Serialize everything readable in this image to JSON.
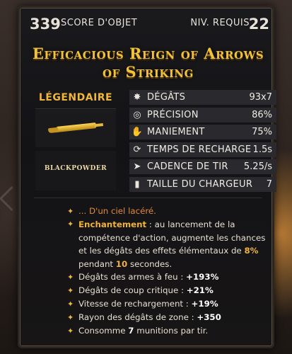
{
  "header": {
    "score_value": "339",
    "score_label": "SCORE D'OBJET",
    "level_label": "NIV. REQUIS",
    "level_value": "22"
  },
  "item": {
    "name": "Efficacious Reign of Arrows of Striking",
    "rarity": "LÉGENDAIRE",
    "brand": "BLACKPOWDER"
  },
  "stats": [
    {
      "icon": "damage-icon",
      "label": "DÉGÂTS",
      "value": "93x7"
    },
    {
      "icon": "accuracy-icon",
      "label": "PRÉCISION",
      "value": "86%"
    },
    {
      "icon": "handling-icon",
      "label": "MANIEMENT",
      "value": "75%"
    },
    {
      "icon": "reload-icon",
      "label": "TEMPS DE RECHARGE",
      "value": "1.5s"
    },
    {
      "icon": "fire-rate-icon",
      "label": "CADENCE DE TIR",
      "value": "5.25/s"
    },
    {
      "icon": "magazine-icon",
      "label": "TAILLE DU CHARGEUR",
      "value": "7"
    }
  ],
  "effects": {
    "flavor": "... D'un ciel lacéré.",
    "enchant_title": "Enchantement",
    "enchant_text_1": " : au lancement de la compétence d'action, augmente les chances et les dégâts des effets élémentaux de ",
    "enchant_pct": "8%",
    "enchant_text_2": " pendant ",
    "enchant_secs": "10",
    "enchant_text_3": " secondes.",
    "firearm_label": "Dégâts des armes à feu : ",
    "firearm_value": "+193%",
    "crit_label": "Dégâts de coup critique : ",
    "crit_value": "+21%",
    "reload_label": "Vitesse de rechargement : ",
    "reload_value": "+19%",
    "aoe_label": "Rayon des dégâts de zone : ",
    "aoe_value": "+350",
    "consume_text_1": "Consomme ",
    "consume_value": "7",
    "consume_text_2": " munitions par tir."
  },
  "colors": {
    "title": "#f2c23a",
    "rarity": "#f0b63a",
    "highlight": "#f1b238",
    "flavor": "#e08a34"
  }
}
